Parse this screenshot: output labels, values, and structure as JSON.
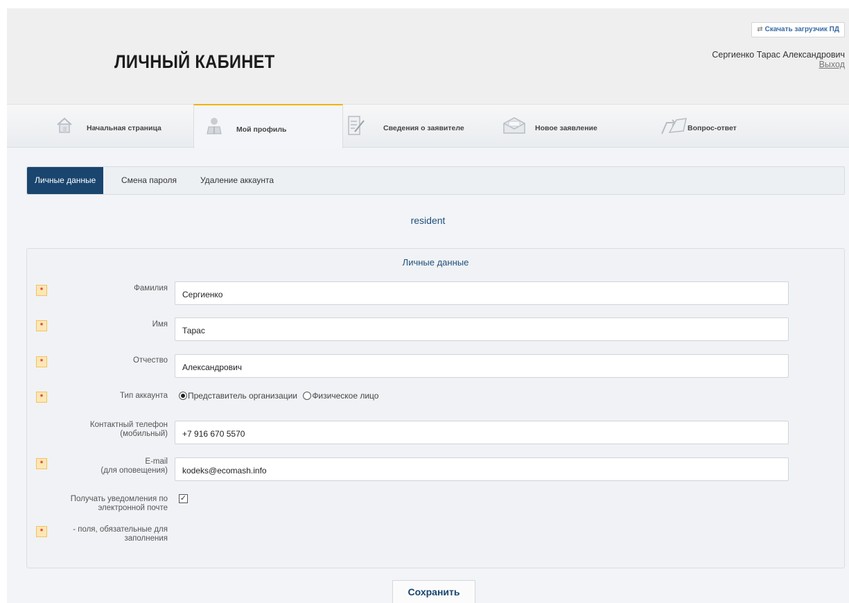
{
  "header": {
    "title": "ЛИЧНЫЙ КАБИНЕТ",
    "download_label": "Скачать загрузчик ПД",
    "user_name": "Сергиенко Тарас Александрович",
    "logout": "Выход"
  },
  "nav": {
    "items": [
      {
        "label": "Начальная страница",
        "icon": "home-icon"
      },
      {
        "label": "Мой профиль",
        "icon": "user-profile-icon"
      },
      {
        "label": "Сведения о заявителе",
        "icon": "document-edit-icon"
      },
      {
        "label": "Новое заявление",
        "icon": "envelope-icon"
      },
      {
        "label": "Вопрос-ответ",
        "icon": "chat-arrows-icon"
      }
    ],
    "active_index": 1
  },
  "subtabs": {
    "items": [
      "Личные данные",
      "Смена пароля",
      "Удаление аккаунта"
    ],
    "active_index": 0
  },
  "login_name": "resident",
  "form": {
    "title": "Личные данные",
    "required_marker": "*",
    "fields": {
      "lastname": {
        "label": "Фамилия",
        "value": "Сергиенко",
        "required": true
      },
      "firstname": {
        "label": "Имя",
        "value": "Тарас",
        "required": true
      },
      "middlename": {
        "label": "Отчество",
        "value": "Александрович",
        "required": true
      },
      "account_type": {
        "label": "Тип аккаунта",
        "required": true,
        "options": [
          "Представитель организации",
          "Физическое лицо"
        ],
        "selected": 0
      },
      "phone": {
        "label_line1": "Контактный телефон",
        "label_line2": "(мобильный)",
        "value": "+7 916 670 5570",
        "required": false
      },
      "email": {
        "label_line1": "E-mail",
        "label_line2": "(для оповещения)",
        "value": "kodeks@ecomash.info",
        "required": true
      },
      "notify": {
        "label_line1": "Получать уведомления по",
        "label_line2": "электронной почте",
        "checked": true
      }
    },
    "legend_line1": "- поля, обязательные для",
    "legend_line2": "заполнения"
  },
  "save_label": "Сохранить",
  "colors": {
    "accent": "#19456f",
    "active_tab_border": "#f0b400",
    "required_bg": "#fde7b5"
  }
}
